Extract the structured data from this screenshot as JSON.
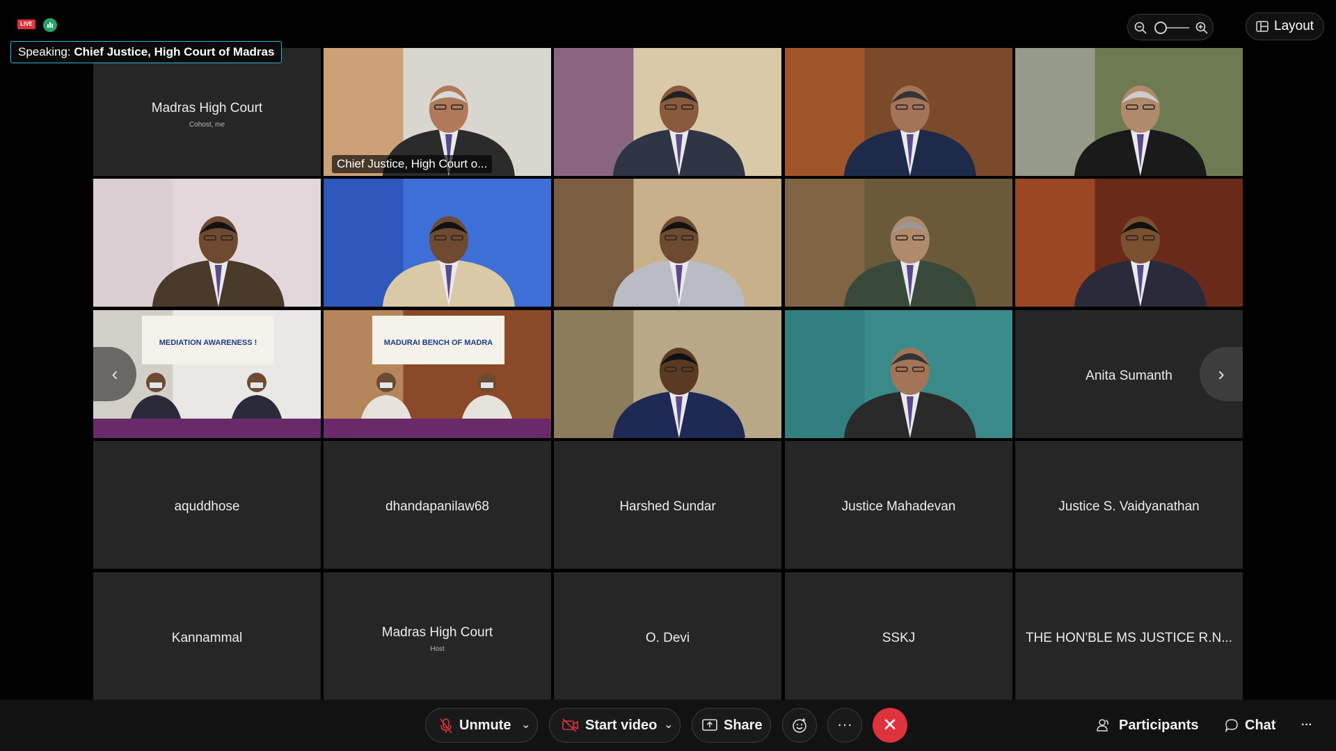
{
  "top": {
    "live_badge": "LIVE",
    "speaking_label": "Speaking:",
    "speaking_name": "Chief Justice, High Court of Madras",
    "layout_label": "Layout"
  },
  "tiles": [
    {
      "name": "Madras High Court",
      "role": "Cohost, me",
      "video": false
    },
    {
      "name": "Chief Justice, High Court o...",
      "video": true,
      "active": true
    },
    {
      "name": "",
      "video": true
    },
    {
      "name": "",
      "video": true
    },
    {
      "name": "",
      "video": true
    },
    {
      "name": "",
      "video": true
    },
    {
      "name": "",
      "video": true
    },
    {
      "name": "",
      "video": true
    },
    {
      "name": "",
      "video": true
    },
    {
      "name": "",
      "video": true
    },
    {
      "name": "",
      "video": true,
      "sign_text": "MEDIATION AWARENESS !"
    },
    {
      "name": "",
      "video": true,
      "sign_text": "MADURAI BENCH OF MADRAS HIGH COURT"
    },
    {
      "name": "",
      "video": true
    },
    {
      "name": "",
      "video": true
    },
    {
      "name": "Anita Sumanth",
      "video": false
    },
    {
      "name": "aquddhose",
      "video": false
    },
    {
      "name": "dhandapanilaw68",
      "video": false
    },
    {
      "name": "Harshed Sundar",
      "video": false
    },
    {
      "name": "Justice Mahadevan",
      "video": false
    },
    {
      "name": "Justice S. Vaidyanathan",
      "video": false
    },
    {
      "name": "Kannammal",
      "video": false
    },
    {
      "name": "Madras High Court",
      "role": "Host",
      "video": false
    },
    {
      "name": "O. Devi",
      "video": false
    },
    {
      "name": "SSKJ",
      "video": false
    },
    {
      "name": "THE HON'BLE MS JUSTICE R.N...",
      "video": false
    }
  ],
  "controls": {
    "unmute": "Unmute",
    "start_video": "Start video",
    "share": "Share",
    "more": "···",
    "participants": "Participants",
    "chat": "Chat",
    "overflow": "···"
  },
  "colors": {
    "accent": "#2ab7d9",
    "end_call": "#e0323c",
    "live": "#d9343e",
    "stats": "#29a36a"
  }
}
